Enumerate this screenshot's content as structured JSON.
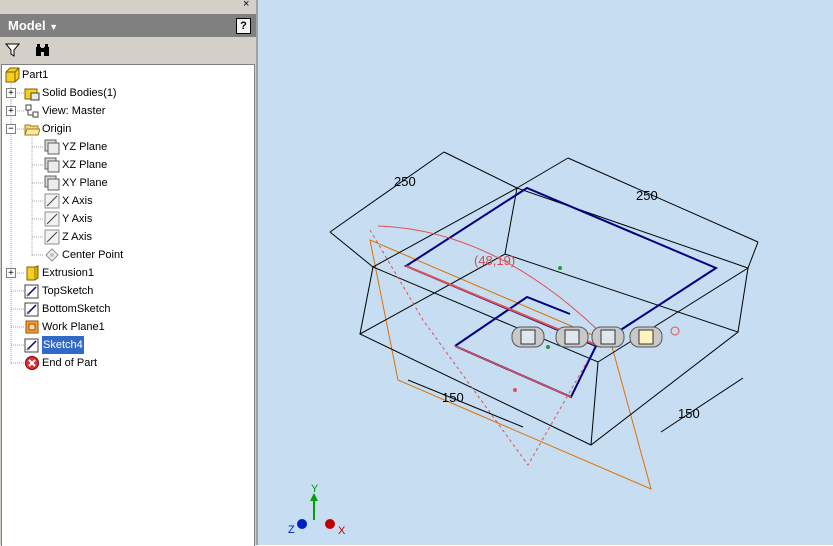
{
  "panel": {
    "title": "Model",
    "pin_glyph": "×",
    "help_glyph": "?",
    "toolbar": [
      {
        "icon": "filter-icon"
      },
      {
        "icon": "binoculars-icon"
      }
    ]
  },
  "tree": {
    "root": "Part1",
    "items": [
      {
        "label": "Solid Bodies(1)",
        "icon": "solid-bodies-icon",
        "expander": "+"
      },
      {
        "label": "View: Master",
        "icon": "view-rep-icon",
        "expander": "+"
      },
      {
        "label": "Origin",
        "icon": "folder-open-icon",
        "expander": "-"
      },
      {
        "label": "YZ Plane",
        "icon": "plane-icon"
      },
      {
        "label": "XZ Plane",
        "icon": "plane-icon"
      },
      {
        "label": "XY Plane",
        "icon": "plane-icon"
      },
      {
        "label": "X Axis",
        "icon": "axis-icon"
      },
      {
        "label": "Y Axis",
        "icon": "axis-icon"
      },
      {
        "label": "Z Axis",
        "icon": "axis-icon"
      },
      {
        "label": "Center Point",
        "icon": "center-point-icon"
      },
      {
        "label": "Extrusion1",
        "icon": "extrusion-icon",
        "expander": "+"
      },
      {
        "label": "TopSketch",
        "icon": "sketch-icon"
      },
      {
        "label": "BottomSketch",
        "icon": "sketch-icon"
      },
      {
        "label": "Work Plane1",
        "icon": "work-plane-icon"
      },
      {
        "label": "Sketch4",
        "icon": "sketch-icon",
        "selected": true
      },
      {
        "label": "End of Part",
        "icon": "end-of-part-icon"
      }
    ]
  },
  "viewport": {
    "background": "#c6ddf2",
    "dimensions": {
      "top_left": "250",
      "top_right": "250",
      "bottom_left": "150",
      "bottom_right": "150",
      "coordinate": "(48,19)"
    },
    "triad": {
      "x_label": "X",
      "y_label": "Y",
      "z_label": "Z"
    },
    "colors": {
      "sketch": "#000080",
      "work_plane": "#e07000",
      "highlight": "#e05050",
      "edges": "#000000"
    }
  }
}
